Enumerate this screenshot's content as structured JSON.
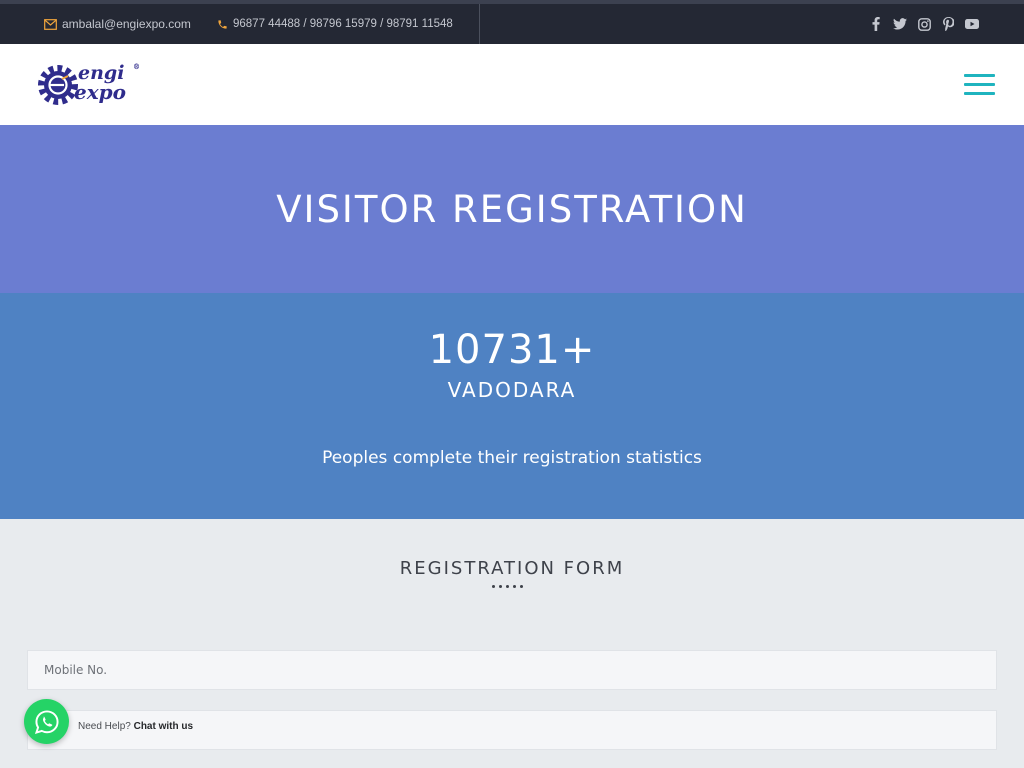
{
  "topbar": {
    "email": "ambalal@engiexpo.com",
    "phones": "96877 44488 / 98796 15979 / 98791 11548",
    "icons": [
      "envelope-icon",
      "phone-icon",
      "facebook-icon",
      "twitter-icon",
      "instagram-icon",
      "pinterest-icon",
      "youtube-icon"
    ]
  },
  "header": {
    "logo_line1": "engi",
    "logo_line2": "expo",
    "logo_reg": "®",
    "menu_icon": "hamburger-menu-icon"
  },
  "hero": {
    "title": "VISITOR REGISTRATION"
  },
  "stats": {
    "count": "10731+",
    "city": "VADODARA",
    "description": "Peoples complete their registration statistics"
  },
  "form": {
    "title": "REGISTRATION FORM",
    "mobile_placeholder": "Mobile No.",
    "second_placeholder": ""
  },
  "whatsapp": {
    "prefix": "Need Help?",
    "link": "Chat with us",
    "icon": "whatsapp-icon"
  },
  "colors": {
    "topbar_bg": "#242834",
    "accent_orange": "#f0a53c",
    "hero_bg": "#6b7dd1",
    "stats_bg": "#4f82c3",
    "menu_teal": "#1fb4bf",
    "whatsapp_green": "#25d366"
  }
}
